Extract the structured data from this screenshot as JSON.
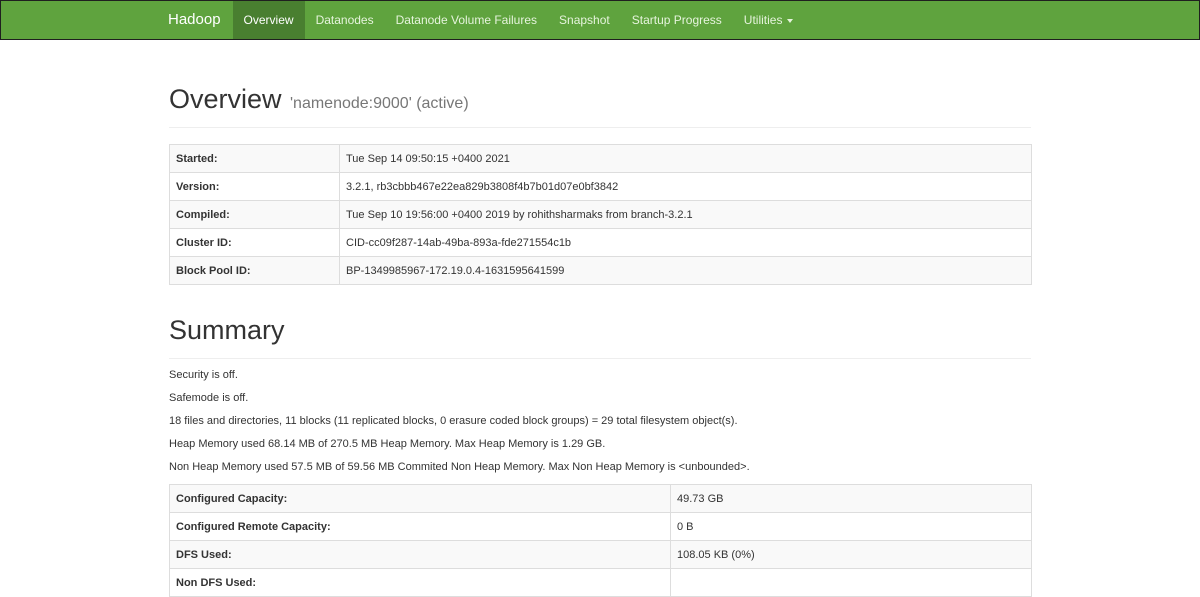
{
  "navbar": {
    "brand": "Hadoop",
    "items": [
      {
        "label": "Overview",
        "active": true
      },
      {
        "label": "Datanodes"
      },
      {
        "label": "Datanode Volume Failures"
      },
      {
        "label": "Snapshot"
      },
      {
        "label": "Startup Progress"
      },
      {
        "label": "Utilities",
        "dropdown": true
      }
    ],
    "colors": {
      "background": "#5fa33e",
      "active": "#497f30"
    }
  },
  "overview": {
    "title": "Overview",
    "host": "'namenode:9000' (active)",
    "rows": [
      {
        "label": "Started:",
        "value": "Tue Sep 14 09:50:15 +0400 2021"
      },
      {
        "label": "Version:",
        "value": "3.2.1, rb3cbbb467e22ea829b3808f4b7b01d07e0bf3842"
      },
      {
        "label": "Compiled:",
        "value": "Tue Sep 10 19:56:00 +0400 2019 by rohithsharmaks from branch-3.2.1"
      },
      {
        "label": "Cluster ID:",
        "value": "CID-cc09f287-14ab-49ba-893a-fde271554c1b"
      },
      {
        "label": "Block Pool ID:",
        "value": "BP-1349985967-172.19.0.4-1631595641599"
      }
    ]
  },
  "summary": {
    "title": "Summary",
    "lines": [
      "Security is off.",
      "Safemode is off.",
      "18 files and directories, 11 blocks (11 replicated blocks, 0 erasure coded block groups) = 29 total filesystem object(s).",
      "Heap Memory used 68.14 MB of 270.5 MB Heap Memory. Max Heap Memory is 1.29 GB.",
      "Non Heap Memory used 57.5 MB of 59.56 MB Commited Non Heap Memory. Max Non Heap Memory is <unbounded>."
    ],
    "capacity_rows": [
      {
        "label": "Configured Capacity:",
        "value": "49.73 GB"
      },
      {
        "label": "Configured Remote Capacity:",
        "value": "0 B"
      },
      {
        "label": "DFS Used:",
        "value": "108.05 KB (0%)"
      },
      {
        "label": "Non DFS Used:",
        "value": ""
      }
    ]
  }
}
